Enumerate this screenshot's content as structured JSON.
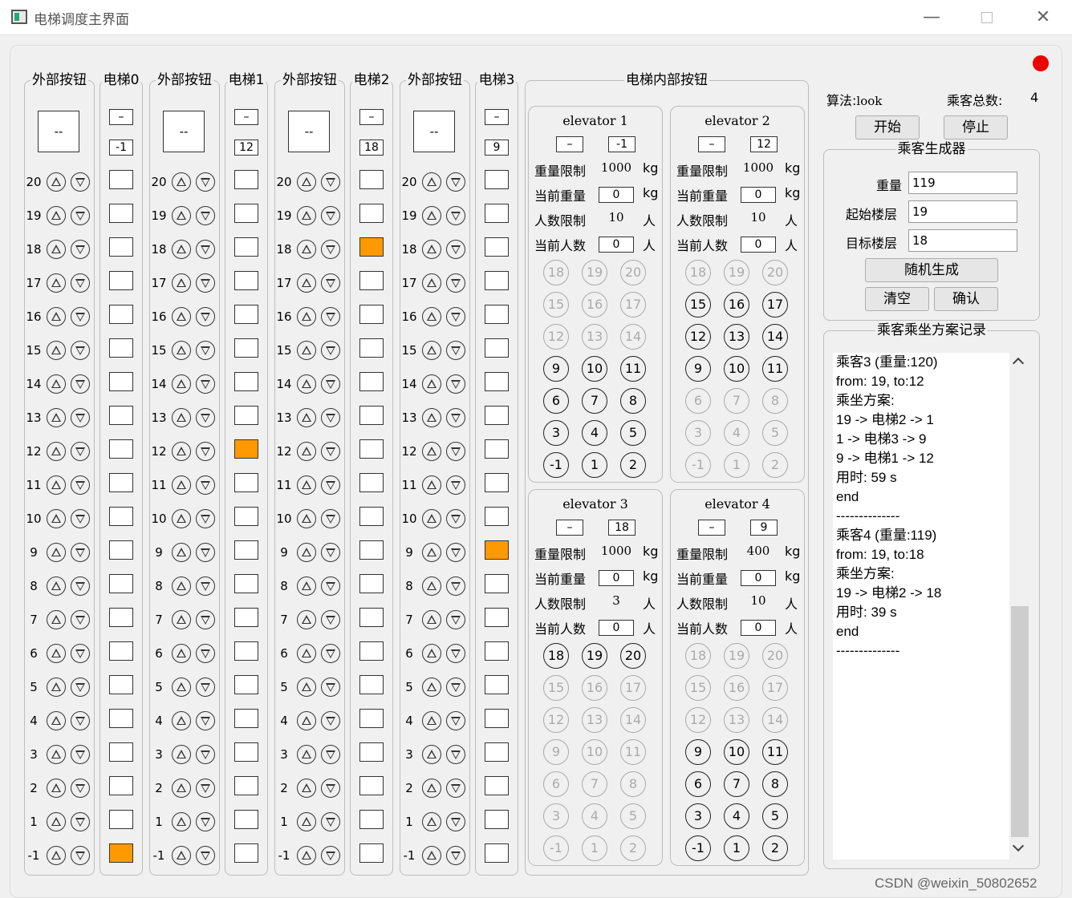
{
  "window": {
    "title": "电梯调度主界面",
    "min_icon": "minimize-icon",
    "max_icon": "maximize-icon",
    "close_icon": "close-icon"
  },
  "status_color": "#ee0000",
  "floors": [
    "20",
    "19",
    "18",
    "17",
    "16",
    "15",
    "14",
    "13",
    "12",
    "11",
    "10",
    "9",
    "8",
    "7",
    "6",
    "5",
    "4",
    "3",
    "2",
    "1",
    "-1"
  ],
  "external": {
    "label": "外部按钮",
    "display": "--"
  },
  "shafts": [
    {
      "label": "电梯0",
      "dir": "–",
      "floor": "-1",
      "current_floor": "-1"
    },
    {
      "label": "电梯1",
      "dir": "–",
      "floor": "12",
      "current_floor": "12"
    },
    {
      "label": "电梯2",
      "dir": "–",
      "floor": "18",
      "current_floor": "18"
    },
    {
      "label": "电梯3",
      "dir": "–",
      "floor": "9",
      "current_floor": "9"
    }
  ],
  "internal": {
    "label": "电梯内部按钮",
    "field_labels": {
      "weight_limit": "重量限制",
      "cur_weight": "当前重量",
      "people_limit": "人数限制",
      "cur_people": "当前人数",
      "kg": "kg",
      "person": "人"
    },
    "button_rows": [
      [
        "18",
        "19",
        "20"
      ],
      [
        "15",
        "16",
        "17"
      ],
      [
        "12",
        "13",
        "14"
      ],
      [
        "9",
        "10",
        "11"
      ],
      [
        "6",
        "7",
        "8"
      ],
      [
        "3",
        "4",
        "5"
      ],
      [
        "-1",
        "1",
        "2"
      ]
    ],
    "elevators": [
      {
        "title": "elevator 1",
        "dir": "–",
        "floor": "-1",
        "weight_limit": "1000",
        "cur_weight": "0",
        "people_limit": "10",
        "cur_people": "0",
        "enabled_rows": [
          3,
          4,
          5,
          6
        ]
      },
      {
        "title": "elevator 2",
        "dir": "–",
        "floor": "12",
        "weight_limit": "1000",
        "cur_weight": "0",
        "people_limit": "10",
        "cur_people": "0",
        "enabled_rows": [
          1,
          2,
          3
        ]
      },
      {
        "title": "elevator 3",
        "dir": "–",
        "floor": "18",
        "weight_limit": "1000",
        "cur_weight": "0",
        "people_limit": "3",
        "cur_people": "0",
        "enabled_rows": [
          0
        ]
      },
      {
        "title": "elevator 4",
        "dir": "–",
        "floor": "9",
        "weight_limit": "400",
        "cur_weight": "0",
        "people_limit": "10",
        "cur_people": "0",
        "enabled_rows": [
          3,
          4,
          5,
          6
        ]
      }
    ]
  },
  "control": {
    "algo_label": "算法:",
    "algo_value": "look",
    "total_label": "乘客总数:",
    "total_value": "4",
    "start": "开始",
    "stop": "停止"
  },
  "generator": {
    "title": "乘客生成器",
    "weight_label": "重量",
    "weight": "119",
    "start_label": "起始楼层",
    "start": "19",
    "target_label": "目标楼层",
    "target": "18",
    "random": "随机生成",
    "clear": "清空",
    "confirm": "确认"
  },
  "log": {
    "title": "乘客乘坐方案记录",
    "lines": [
      "乘客3 (重量:120)",
      "from: 19, to:12",
      "乘坐方案:",
      "19 -> 电梯2 -> 1",
      "1 -> 电梯3 -> 9",
      "9 -> 电梯1 -> 12",
      "用时: 59 s",
      "end",
      "--------------",
      "",
      "乘客4 (重量:119)",
      "from: 19, to:18",
      "乘坐方案:",
      "19 -> 电梯2 -> 18",
      "用时: 39 s",
      "end",
      "--------------"
    ],
    "up_icon": "scroll-up-icon",
    "down_icon": "scroll-down-icon"
  },
  "watermark": "CSDN @weixin_50802652"
}
